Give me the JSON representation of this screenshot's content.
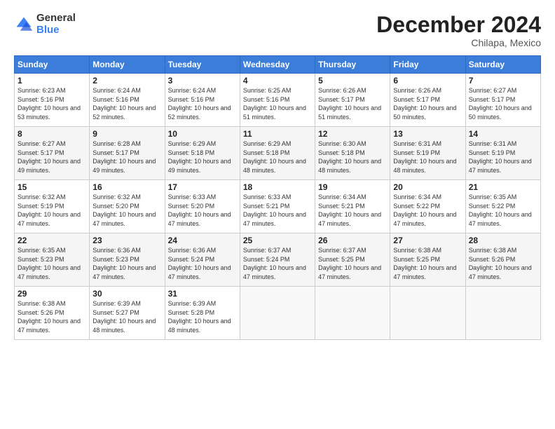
{
  "logo": {
    "general": "General",
    "blue": "Blue"
  },
  "header": {
    "month": "December 2024",
    "location": "Chilapa, Mexico"
  },
  "weekdays": [
    "Sunday",
    "Monday",
    "Tuesday",
    "Wednesday",
    "Thursday",
    "Friday",
    "Saturday"
  ],
  "weeks": [
    [
      {
        "day": "1",
        "sunrise": "6:23 AM",
        "sunset": "5:16 PM",
        "daylight": "10 hours and 53 minutes."
      },
      {
        "day": "2",
        "sunrise": "6:24 AM",
        "sunset": "5:16 PM",
        "daylight": "10 hours and 52 minutes."
      },
      {
        "day": "3",
        "sunrise": "6:24 AM",
        "sunset": "5:16 PM",
        "daylight": "10 hours and 52 minutes."
      },
      {
        "day": "4",
        "sunrise": "6:25 AM",
        "sunset": "5:16 PM",
        "daylight": "10 hours and 51 minutes."
      },
      {
        "day": "5",
        "sunrise": "6:26 AM",
        "sunset": "5:17 PM",
        "daylight": "10 hours and 51 minutes."
      },
      {
        "day": "6",
        "sunrise": "6:26 AM",
        "sunset": "5:17 PM",
        "daylight": "10 hours and 50 minutes."
      },
      {
        "day": "7",
        "sunrise": "6:27 AM",
        "sunset": "5:17 PM",
        "daylight": "10 hours and 50 minutes."
      }
    ],
    [
      {
        "day": "8",
        "sunrise": "6:27 AM",
        "sunset": "5:17 PM",
        "daylight": "10 hours and 49 minutes."
      },
      {
        "day": "9",
        "sunrise": "6:28 AM",
        "sunset": "5:17 PM",
        "daylight": "10 hours and 49 minutes."
      },
      {
        "day": "10",
        "sunrise": "6:29 AM",
        "sunset": "5:18 PM",
        "daylight": "10 hours and 49 minutes."
      },
      {
        "day": "11",
        "sunrise": "6:29 AM",
        "sunset": "5:18 PM",
        "daylight": "10 hours and 48 minutes."
      },
      {
        "day": "12",
        "sunrise": "6:30 AM",
        "sunset": "5:18 PM",
        "daylight": "10 hours and 48 minutes."
      },
      {
        "day": "13",
        "sunrise": "6:31 AM",
        "sunset": "5:19 PM",
        "daylight": "10 hours and 48 minutes."
      },
      {
        "day": "14",
        "sunrise": "6:31 AM",
        "sunset": "5:19 PM",
        "daylight": "10 hours and 47 minutes."
      }
    ],
    [
      {
        "day": "15",
        "sunrise": "6:32 AM",
        "sunset": "5:19 PM",
        "daylight": "10 hours and 47 minutes."
      },
      {
        "day": "16",
        "sunrise": "6:32 AM",
        "sunset": "5:20 PM",
        "daylight": "10 hours and 47 minutes."
      },
      {
        "day": "17",
        "sunrise": "6:33 AM",
        "sunset": "5:20 PM",
        "daylight": "10 hours and 47 minutes."
      },
      {
        "day": "18",
        "sunrise": "6:33 AM",
        "sunset": "5:21 PM",
        "daylight": "10 hours and 47 minutes."
      },
      {
        "day": "19",
        "sunrise": "6:34 AM",
        "sunset": "5:21 PM",
        "daylight": "10 hours and 47 minutes."
      },
      {
        "day": "20",
        "sunrise": "6:34 AM",
        "sunset": "5:22 PM",
        "daylight": "10 hours and 47 minutes."
      },
      {
        "day": "21",
        "sunrise": "6:35 AM",
        "sunset": "5:22 PM",
        "daylight": "10 hours and 47 minutes."
      }
    ],
    [
      {
        "day": "22",
        "sunrise": "6:35 AM",
        "sunset": "5:23 PM",
        "daylight": "10 hours and 47 minutes."
      },
      {
        "day": "23",
        "sunrise": "6:36 AM",
        "sunset": "5:23 PM",
        "daylight": "10 hours and 47 minutes."
      },
      {
        "day": "24",
        "sunrise": "6:36 AM",
        "sunset": "5:24 PM",
        "daylight": "10 hours and 47 minutes."
      },
      {
        "day": "25",
        "sunrise": "6:37 AM",
        "sunset": "5:24 PM",
        "daylight": "10 hours and 47 minutes."
      },
      {
        "day": "26",
        "sunrise": "6:37 AM",
        "sunset": "5:25 PM",
        "daylight": "10 hours and 47 minutes."
      },
      {
        "day": "27",
        "sunrise": "6:38 AM",
        "sunset": "5:25 PM",
        "daylight": "10 hours and 47 minutes."
      },
      {
        "day": "28",
        "sunrise": "6:38 AM",
        "sunset": "5:26 PM",
        "daylight": "10 hours and 47 minutes."
      }
    ],
    [
      {
        "day": "29",
        "sunrise": "6:38 AM",
        "sunset": "5:26 PM",
        "daylight": "10 hours and 47 minutes."
      },
      {
        "day": "30",
        "sunrise": "6:39 AM",
        "sunset": "5:27 PM",
        "daylight": "10 hours and 48 minutes."
      },
      {
        "day": "31",
        "sunrise": "6:39 AM",
        "sunset": "5:28 PM",
        "daylight": "10 hours and 48 minutes."
      },
      null,
      null,
      null,
      null
    ]
  ]
}
